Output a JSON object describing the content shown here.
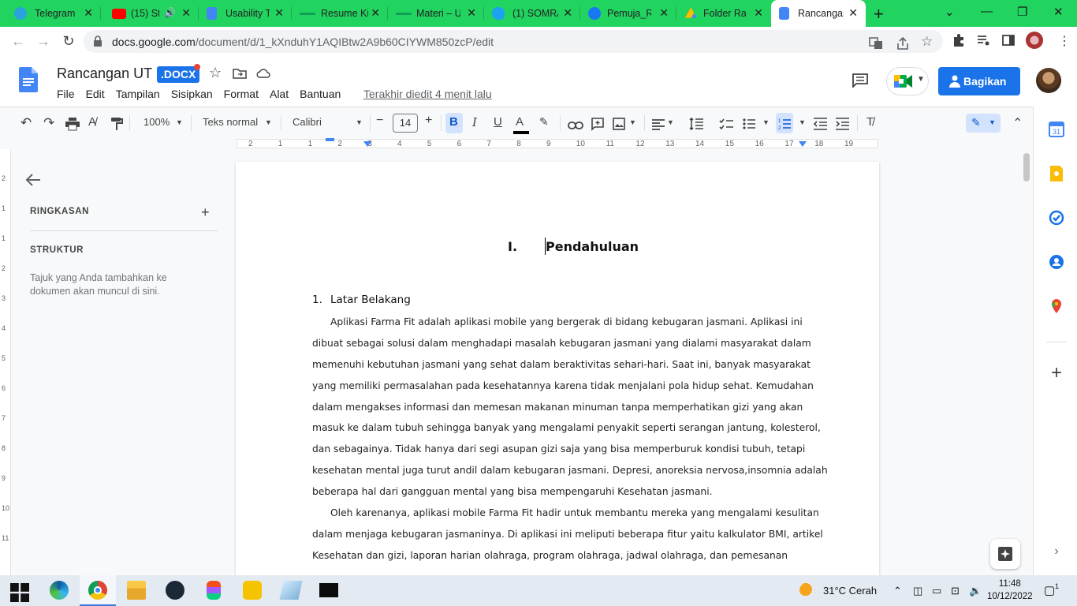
{
  "browser": {
    "tabs": [
      {
        "label": "Telegram W",
        "color": "#2aa3dc"
      },
      {
        "label": "(15) St",
        "color": "#ff0000"
      },
      {
        "label": "Usability Te",
        "color": "#4285f4"
      },
      {
        "label": "Resume Ki",
        "color": "#0f9d58"
      },
      {
        "label": "Materi – U",
        "color": "#0f9d58"
      },
      {
        "label": "(1) SOMRA",
        "color": "#1da1f2"
      },
      {
        "label": "Pemuja_Ra",
        "color": "#1877f2"
      },
      {
        "label": "Folder Ran",
        "color": "#fbbc04"
      },
      {
        "label": "Rancangan",
        "color": "#4285f4"
      }
    ],
    "new_tab": "+",
    "url_host": "docs.google.com",
    "url_path": "/document/d/1_kXnduhY1AQIBtw2A9b60CIYWM850zcP/edit"
  },
  "doc": {
    "title": "Rancangan UT",
    "badge": ".DOCX",
    "menu": [
      "File",
      "Edit",
      "Tampilan",
      "Sisipkan",
      "Format",
      "Alat",
      "Bantuan"
    ],
    "last_edit": "Terakhir diedit 4 menit lalu",
    "share_label": "Bagikan"
  },
  "toolbar": {
    "zoom": "100%",
    "style": "Teks normal",
    "font": "Calibri",
    "font_size": "14"
  },
  "ruler": {
    "h_ticks": [
      "2",
      "1",
      "1",
      "2",
      "3",
      "4",
      "5",
      "6",
      "7",
      "8",
      "9",
      "10",
      "11",
      "12",
      "13",
      "14",
      "15",
      "16",
      "17",
      "18",
      "19"
    ],
    "v_ticks": [
      "2",
      "1",
      "1",
      "2",
      "3",
      "4",
      "5",
      "6",
      "7",
      "8",
      "9",
      "10",
      "11"
    ]
  },
  "outline": {
    "summary_label": "RINGKASAN",
    "structure_label": "STRUKTUR",
    "hint": "Tajuk yang Anda tambahkan ke dokumen akan muncul di sini."
  },
  "content": {
    "heading_num": "I.",
    "heading_text": "Pendahuluan",
    "sub_num": "1.",
    "sub_text": "Latar Belakang",
    "lines": [
      "Aplikasi Farma Fit adalah aplikasi mobile yang bergerak di bidang kebugaran jasmani. Aplikasi ini",
      "dibuat sebagai solusi dalam menghadapi masalah kebugaran jasmani yang dialami masyarakat dalam",
      "memenuhi kebutuhan jasmani yang sehat dalam beraktivitas sehari-hari. Saat ini, banyak masyarakat",
      "yang memiliki permasalahan pada kesehatannya karena tidak menjalani pola hidup sehat. Kemudahan",
      "dalam mengakses informasi dan memesan makanan minuman tanpa memperhatikan gizi yang akan",
      "masuk ke dalam tubuh sehingga banyak yang mengalami penyakit seperti serangan jantung, kolesterol,",
      "dan sebagainya. Tidak hanya dari segi asupan gizi saja yang bisa memperburuk kondisi tubuh, tetapi",
      "kesehatan mental juga turut andil dalam kebugaran jasmani. Depresi, anoreksia nervosa,insomnia adalah",
      "beberapa hal dari gangguan mental yang bisa mempengaruhi Kesehatan jasmani.",
      "Oleh karenanya, aplikasi mobile Farma Fit hadir untuk membantu mereka yang mengalami kesulitan",
      "dalam menjaga kebugaran jasmaninya. Di aplikasi ini meliputi beberapa fitur yaitu kalkulator BMI, artikel",
      "Kesehatan dan gizi, laporan harian olahraga, program olahraga, jadwal olahraga, dan pemesanan"
    ]
  },
  "taskbar": {
    "weather": "31°C  Cerah",
    "time": "11:48",
    "date": "10/12/2022",
    "notif_count": "1"
  }
}
